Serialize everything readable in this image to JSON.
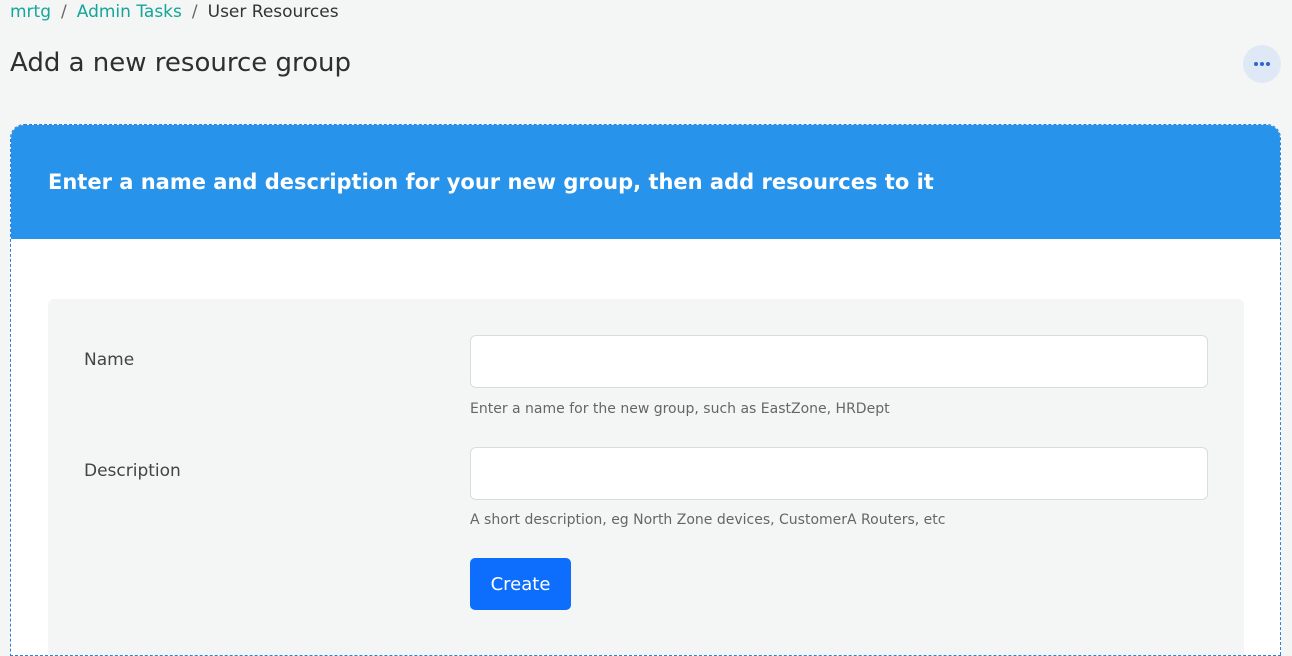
{
  "breadcrumb": {
    "items": [
      {
        "label": "mrtg"
      },
      {
        "label": "Admin Tasks"
      }
    ],
    "current": "User Resources",
    "separator": "/"
  },
  "header": {
    "title": "Add a new resource group",
    "more_icon": "ellipsis-horizontal-icon"
  },
  "card": {
    "heading": "Enter a name and description for your new group, then add resources to it"
  },
  "form": {
    "name": {
      "label": "Name",
      "value": "",
      "help": "Enter a name for the new group, such as EastZone, HRDept"
    },
    "description": {
      "label": "Description",
      "value": "",
      "help": "A short description, eg North Zone devices, CustomerA Routers, etc"
    },
    "submit_label": "Create"
  },
  "colors": {
    "link": "#15a59a",
    "card_header": "#2893ea",
    "primary_button": "#0d6efd",
    "more_button_bg": "#dfe9f6"
  }
}
